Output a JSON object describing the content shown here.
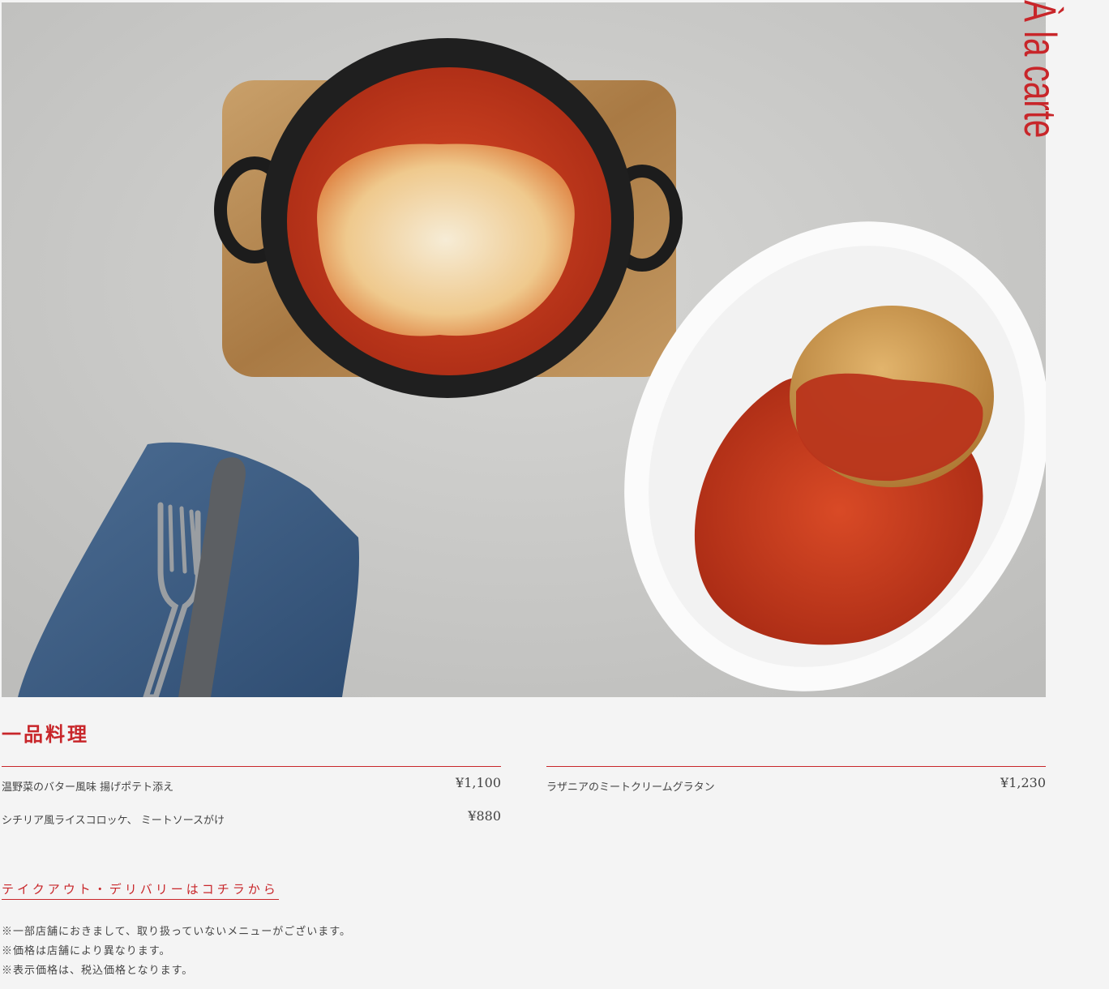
{
  "hero": {
    "vertical_title": "À la carte",
    "colors": {
      "accent": "#c8262a",
      "background": "#f4f4f4"
    }
  },
  "section": {
    "title": "一品料理"
  },
  "menu": {
    "left": [
      {
        "name": "温野菜のバター風味 揚げポテト添え",
        "price": "¥1,100"
      },
      {
        "name": "シチリア風ライスコロッケ、 ミートソースがけ",
        "price": "¥880"
      }
    ],
    "right": [
      {
        "name": "ラザニアのミートクリームグラタン",
        "price": "¥1,230"
      }
    ]
  },
  "takeout": {
    "label": "テイクアウト・デリバリーはコチラから"
  },
  "notes": [
    "※一部店舗におきまして、取り扱っていないメニューがございます。",
    "※価格は店舗により異なります。",
    "※表示価格は、税込価格となります。"
  ]
}
